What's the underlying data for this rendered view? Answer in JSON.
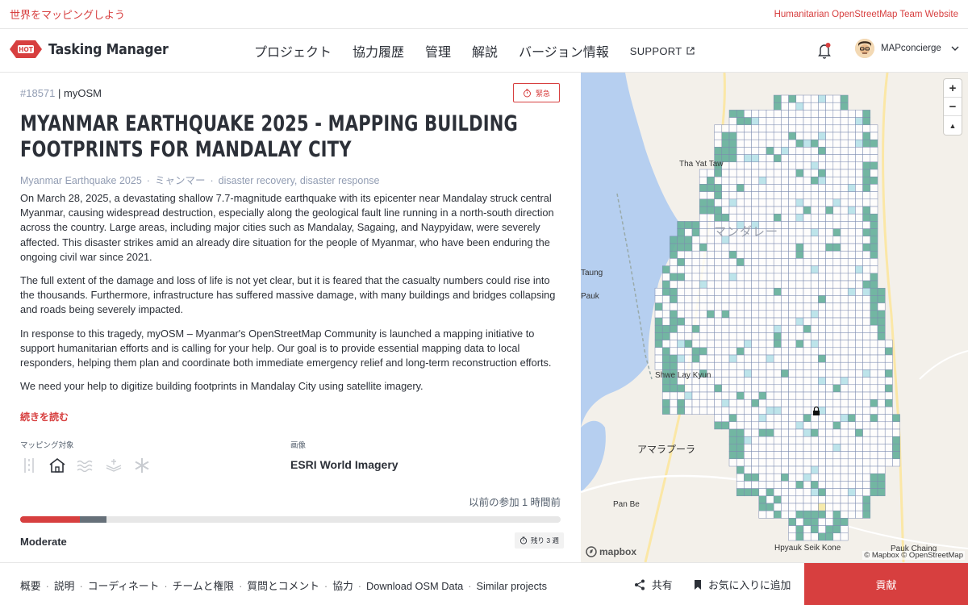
{
  "topbar": {
    "tagline": "世界をマッピングしよう",
    "hot_link": "Humanitarian OpenStreetMap Team Website"
  },
  "header": {
    "logo_badge": "HOT",
    "app_title": "Tasking Manager",
    "menu": [
      "プロジェクト",
      "協力履歴",
      "管理",
      "解説",
      "バージョン情報"
    ],
    "support": "SUPPORT",
    "username": "MAPconcierge"
  },
  "project": {
    "id": "#18571",
    "org": "myOSM",
    "priority_label": "緊急",
    "title": "MYANMAR EARTHQUAKE 2025 - MAPPING BUILDING FOOTPRINTS FOR MANDALAY CITY",
    "campaign": "Myanmar Earthquake 2025",
    "country": "ミャンマー",
    "interests": "disaster recovery, disaster response",
    "description": [
      "On March 28, 2025, a devastating shallow 7.7-magnitude earthquake with its epicenter near Mandalay struck central Myanmar, causing widespread destruction, especially along the geological fault line running in a north-south direction across the country. Large areas, including major cities such as Mandalay, Sagaing, and Naypyidaw, were severely affected. This disaster strikes amid an already dire situation for the people of Myanmar, who have been enduring the ongoing civil war since 2021.",
      "The full extent of the damage and loss of life is not yet clear, but it is feared that the casualty numbers could rise into the thousands. Furthermore, infrastructure has suffered massive damage, with many buildings and bridges collapsing and roads being severely impacted.",
      "In response to this tragedy, myOSM – Myanmar's OpenStreetMap Community is launched a mapping initiative to support humanitarian efforts and is calling for your help. Our goal is to provide essential mapping data to local responders, helping them plan and coordinate both immediate emergency relief and long-term reconstruction efforts.",
      "We need your help to digitize building footprints in Mandalay City using satellite imagery."
    ],
    "read_more": "続きを読む",
    "mapping_types_label": "マッピング対象",
    "mapping_type_icons": [
      "road-icon",
      "building-icon",
      "waterway-icon",
      "landuse-icon",
      "other-icon"
    ],
    "imagery_label": "画像",
    "imagery_value": "ESRI World Imagery",
    "last_contribution": "以前の参加 1 時間前",
    "percent_mapped": 11,
    "percent_validated": 5,
    "difficulty": "Moderate",
    "time_remaining": "残り 3 週"
  },
  "map": {
    "labels": {
      "tha_yat_taw": "Tha Yat Taw",
      "mandalay": "マンダレー",
      "taung": "Taung",
      "pauk": "Pauk",
      "shwe_lay_kyun": "Shwe\nLay Kyun",
      "amarapura": "アマラプーラ",
      "pan_be": "Pan Be",
      "hpyauk_seik_kone": "Hpyauk\nSeik Kone",
      "pauk_chaing": "Pauk Chaing"
    },
    "zoom_in": "+",
    "zoom_out": "−",
    "compass": "▲",
    "mapbox": "mapbox",
    "attribution": "© Mapbox © OpenStreetMap"
  },
  "footer": {
    "nav": [
      "概要",
      "説明",
      "コーディネート",
      "チームと権限",
      "質問とコメント",
      "協力",
      "Download OSM Data",
      "Similar projects"
    ],
    "share": "共有",
    "favorite": "お気に入りに追加",
    "contribute": "貢献"
  },
  "colors": {
    "brand_red": "#d73f3f",
    "mapped_green": "#6ab29e",
    "validated_blue": "#b9e3ea",
    "grid_line": "#7c8bb0",
    "water": "#b6cff0"
  }
}
